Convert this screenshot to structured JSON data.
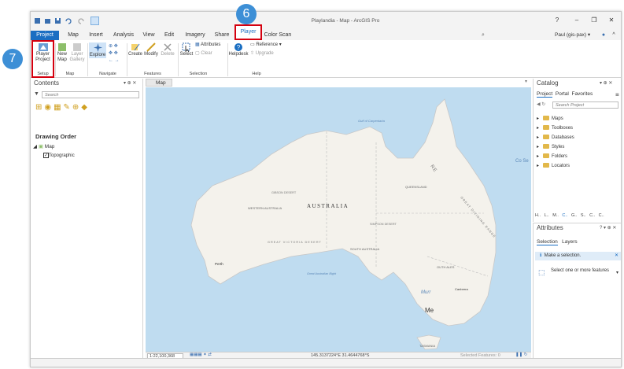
{
  "window": {
    "title": "Playlandia - Map - ArcGIS Pro",
    "help": "?",
    "minimize": "–",
    "restore": "❐",
    "close": "✕"
  },
  "tabs": [
    {
      "label": "Project"
    },
    {
      "label": "Map"
    },
    {
      "label": "Insert"
    },
    {
      "label": "Analysis"
    },
    {
      "label": "View"
    },
    {
      "label": "Edit"
    },
    {
      "label": "Imagery"
    },
    {
      "label": "Share"
    },
    {
      "label": "Player"
    },
    {
      "label": "Color Scan"
    }
  ],
  "user": {
    "name": "Paul (gis-pax)",
    "dropdown": "▾"
  },
  "ribbon": {
    "setup": {
      "btn": "Player Project",
      "group": "Setup"
    },
    "map": {
      "new_map": "New Map",
      "layer_gallery": "Layer Gallery",
      "group": "Map"
    },
    "navigate": {
      "explore": "Explore",
      "group": "Navigate"
    },
    "features": {
      "create": "Create",
      "modify": "Modify",
      "delete": "Delete",
      "group": "Features"
    },
    "selection": {
      "select": "Select",
      "attributes": "Attributes",
      "clear": "Clear",
      "group": "Selection"
    },
    "help": {
      "helpdesk": "Helpdesk",
      "reference": "Reference",
      "upgrade": "Upgrade",
      "group": "Help"
    }
  },
  "badges": {
    "six": "6",
    "seven": "7"
  },
  "contents": {
    "title": "Contents",
    "search_placeholder": "Search",
    "drawing_order": "Drawing Order",
    "map_layer": "Map",
    "basemap": "Topographic"
  },
  "mapview": {
    "tab": "Map",
    "labels": {
      "australia": "AUSTRALIA",
      "gulf": "Gulf of Carpentaria",
      "coral": "Co Se",
      "queensland": "QUEENSLAND",
      "gibson": "GIBSON DESERT",
      "western": "WESTERN AUSTRALIA",
      "simpson": "SIMPSON DESERT",
      "victoria": "GREAT VICTORIA DESERT",
      "south": "SOUTH AUSTRALIA",
      "perth": "Perth",
      "bight": "Great Australian Bight",
      "nsw": "OUTH ALES",
      "canberra": "Canberra",
      "murray": "Murr",
      "melbourne": "Me",
      "tasmania": "TASMANIA",
      "range": "GREAT DIVIDING RANGE",
      "reef": "RE"
    },
    "scale": "1:22,100,368",
    "coords": "145.3137224°E 31.4644768°S",
    "selected": "Selected Features: 0"
  },
  "catalog": {
    "title": "Catalog",
    "tabs": [
      "Project",
      "Portal",
      "Favorites"
    ],
    "search_placeholder": "Search Project",
    "items": [
      "Maps",
      "Toolboxes",
      "Databases",
      "Styles",
      "Folders",
      "Locators"
    ],
    "bottom_tabs": [
      "H..",
      "L..",
      "M..",
      "C..",
      "G..",
      "S..",
      "C..",
      "C.."
    ]
  },
  "attributes": {
    "title": "Attributes",
    "tab_selection": "Selection",
    "tab_layers": "Layers",
    "info": "Make a selection.",
    "select_label": "Select one or more features"
  },
  "colors": {
    "accent": "#1a6ec2",
    "highlight": "#d4000f",
    "badge": "#3d8fd6",
    "water": "#bfdcf0",
    "land": "#f4f2ec"
  }
}
